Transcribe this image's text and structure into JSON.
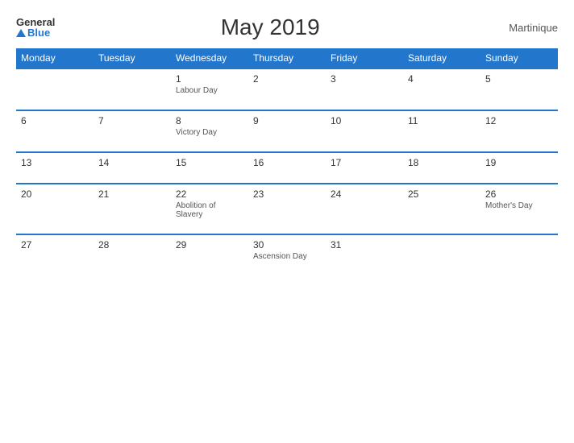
{
  "header": {
    "logo_general": "General",
    "logo_blue": "Blue",
    "title": "May 2019",
    "region": "Martinique"
  },
  "days_header": [
    "Monday",
    "Tuesday",
    "Wednesday",
    "Thursday",
    "Friday",
    "Saturday",
    "Sunday"
  ],
  "weeks": [
    [
      {
        "num": "",
        "holiday": ""
      },
      {
        "num": "",
        "holiday": ""
      },
      {
        "num": "1",
        "holiday": "Labour Day"
      },
      {
        "num": "2",
        "holiday": ""
      },
      {
        "num": "3",
        "holiday": ""
      },
      {
        "num": "4",
        "holiday": ""
      },
      {
        "num": "5",
        "holiday": ""
      }
    ],
    [
      {
        "num": "6",
        "holiday": ""
      },
      {
        "num": "7",
        "holiday": ""
      },
      {
        "num": "8",
        "holiday": "Victory Day"
      },
      {
        "num": "9",
        "holiday": ""
      },
      {
        "num": "10",
        "holiday": ""
      },
      {
        "num": "11",
        "holiday": ""
      },
      {
        "num": "12",
        "holiday": ""
      }
    ],
    [
      {
        "num": "13",
        "holiday": ""
      },
      {
        "num": "14",
        "holiday": ""
      },
      {
        "num": "15",
        "holiday": ""
      },
      {
        "num": "16",
        "holiday": ""
      },
      {
        "num": "17",
        "holiday": ""
      },
      {
        "num": "18",
        "holiday": ""
      },
      {
        "num": "19",
        "holiday": ""
      }
    ],
    [
      {
        "num": "20",
        "holiday": ""
      },
      {
        "num": "21",
        "holiday": ""
      },
      {
        "num": "22",
        "holiday": "Abolition of Slavery"
      },
      {
        "num": "23",
        "holiday": ""
      },
      {
        "num": "24",
        "holiday": ""
      },
      {
        "num": "25",
        "holiday": ""
      },
      {
        "num": "26",
        "holiday": "Mother's Day"
      }
    ],
    [
      {
        "num": "27",
        "holiday": ""
      },
      {
        "num": "28",
        "holiday": ""
      },
      {
        "num": "29",
        "holiday": ""
      },
      {
        "num": "30",
        "holiday": "Ascension Day"
      },
      {
        "num": "31",
        "holiday": ""
      },
      {
        "num": "",
        "holiday": ""
      },
      {
        "num": "",
        "holiday": ""
      }
    ]
  ]
}
